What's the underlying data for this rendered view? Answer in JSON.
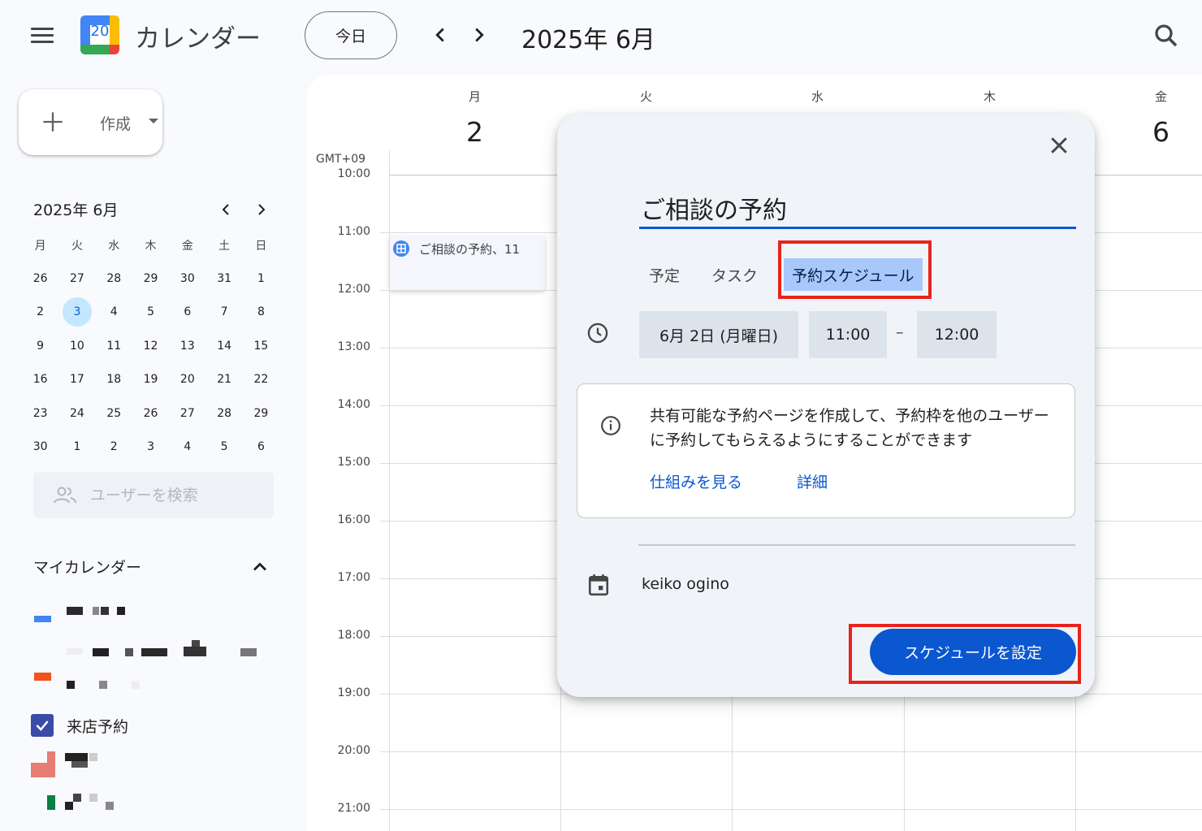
{
  "header": {
    "app_title": "カレンダー",
    "logo_number": "20",
    "today_label": "今日",
    "period": "2025年 6月",
    "icons": [
      "menu-icon",
      "chevron-left-icon",
      "chevron-right-icon",
      "search-icon"
    ]
  },
  "sidebar": {
    "create_label": "作成",
    "mini_calendar": {
      "title": "2025年 6月",
      "weekdays": [
        "月",
        "火",
        "水",
        "木",
        "金",
        "土",
        "日"
      ],
      "weeks": [
        [
          "26",
          "27",
          "28",
          "29",
          "30",
          "31",
          "1"
        ],
        [
          "2",
          "3",
          "4",
          "5",
          "6",
          "7",
          "8"
        ],
        [
          "9",
          "10",
          "11",
          "12",
          "13",
          "14",
          "15"
        ],
        [
          "16",
          "17",
          "18",
          "19",
          "20",
          "21",
          "22"
        ],
        [
          "23",
          "24",
          "25",
          "26",
          "27",
          "28",
          "29"
        ],
        [
          "30",
          "1",
          "2",
          "3",
          "4",
          "5",
          "6"
        ]
      ],
      "selected": "3"
    },
    "user_search_placeholder": "ユーザーを検索",
    "my_calendars_title": "マイカレンダー",
    "calendar_item_label": "来店予約",
    "colors": {
      "blue": "#4285f4",
      "orange": "#f4511e",
      "checkbox": "#3f51b5",
      "pink": "#e67c73",
      "green": "#0b8043"
    }
  },
  "grid": {
    "timezone": "GMT+09",
    "days": [
      {
        "dow": "月",
        "date": "2"
      },
      {
        "dow": "火",
        "date": ""
      },
      {
        "dow": "水",
        "date": ""
      },
      {
        "dow": "木",
        "date": ""
      },
      {
        "dow": "金",
        "date": "6"
      }
    ],
    "hours": [
      "10:00",
      "11:00",
      "12:00",
      "13:00",
      "14:00",
      "15:00",
      "16:00",
      "17:00",
      "18:00",
      "19:00",
      "20:00",
      "21:00"
    ],
    "event_label": "ご相談の予約、11"
  },
  "dialog": {
    "title_value": "ご相談の予約",
    "tabs": [
      "予定",
      "タスク",
      "予約スケジュール"
    ],
    "active_tab": "予約スケジュール",
    "date_chip": "6月 2日 (月曜日)",
    "start_time": "11:00",
    "dash": "–",
    "end_time": "12:00",
    "info_text": "共有可能な予約ページを作成して、予約枠を他のユーザーに予約してもらえるようにすることができます",
    "link_how": "仕組みを見る",
    "link_details": "詳細",
    "owner": "keiko ogino",
    "primary_button": "スケジュールを設定",
    "accent": "#0b57d0",
    "highlight_color": "#e8231c"
  }
}
